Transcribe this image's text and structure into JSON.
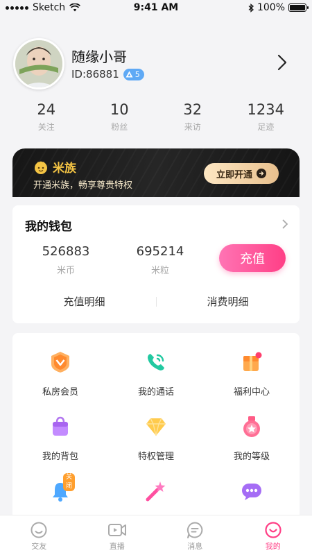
{
  "status_bar": {
    "carrier": "Sketch",
    "time": "9:41 AM",
    "battery": "100%"
  },
  "profile": {
    "name": "随缘小哥",
    "id_text": "ID:86881",
    "level": "5"
  },
  "stats": [
    {
      "value": "24",
      "label": "关注"
    },
    {
      "value": "10",
      "label": "粉丝"
    },
    {
      "value": "32",
      "label": "来访"
    },
    {
      "value": "1234",
      "label": "足迹"
    }
  ],
  "vip": {
    "title": "米族",
    "subtitle": "开通米族，畅享尊贵特权",
    "button": "立即开通"
  },
  "wallet": {
    "title": "我的钱包",
    "coins": {
      "value": "526883",
      "label": "米币"
    },
    "grains": {
      "value": "695214",
      "label": "米粒"
    },
    "recharge": "充值",
    "recharge_detail": "充值明细",
    "spend_detail": "消费明细"
  },
  "features": [
    {
      "label": "私房会员",
      "icon": "shield-v-icon"
    },
    {
      "label": "我的通话",
      "icon": "phone-icon"
    },
    {
      "label": "福利中心",
      "icon": "gift-icon"
    },
    {
      "label": "我的背包",
      "icon": "bag-icon"
    },
    {
      "label": "特权管理",
      "icon": "diamond-icon"
    },
    {
      "label": "我的等级",
      "icon": "medal-icon"
    },
    {
      "label": "",
      "icon": "bell-icon",
      "badge": "关闭"
    },
    {
      "label": "",
      "icon": "magic-wand-icon"
    },
    {
      "label": "",
      "icon": "chat-bubbles-icon"
    }
  ],
  "tabs": [
    {
      "label": "交友",
      "icon": "smile-icon"
    },
    {
      "label": "直播",
      "icon": "video-icon"
    },
    {
      "label": "消息",
      "icon": "message-icon"
    },
    {
      "label": "我的",
      "icon": "profile-icon",
      "active": true
    }
  ],
  "colors": {
    "accent": "#ff3f86",
    "gold": "#f5c544"
  }
}
